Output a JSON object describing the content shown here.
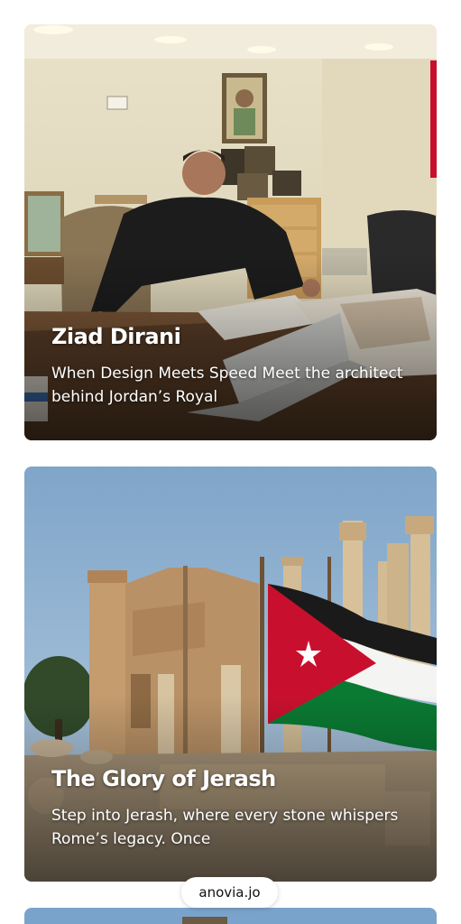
{
  "feed": {
    "cards": [
      {
        "title": "Ziad Dirani",
        "description": "When Design Meets Speed Meet the architect behind Jordan’s Royal"
      },
      {
        "title": "The Glory of Jerash",
        "description": "Step into Jerash, where every stone whispers Rome’s legacy. Once"
      }
    ],
    "source_label": "anovia.jo"
  },
  "colors": {
    "flag_red": "#c8102e",
    "flag_black": "#1a1a1a",
    "flag_green": "#0a7a33",
    "sky": "#8fb3d4"
  }
}
